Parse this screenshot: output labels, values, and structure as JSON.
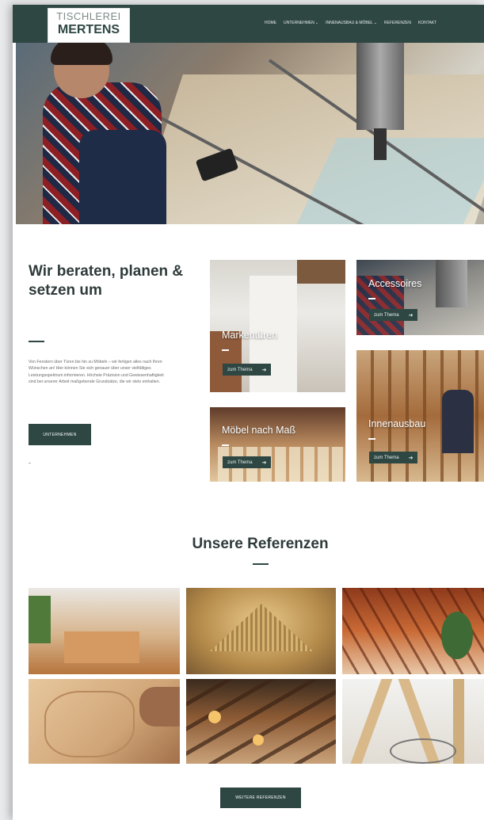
{
  "header": {
    "logo_top": "TISCHLEREI",
    "logo_bottom": "MERTENS",
    "nav": [
      {
        "label": "HOME",
        "dropdown": false
      },
      {
        "label": "UNTERNEHMEN",
        "dropdown": true
      },
      {
        "label": "INNENAUSBAU & MÖBEL",
        "dropdown": true
      },
      {
        "label": "REFERENZEN",
        "dropdown": false
      },
      {
        "label": "KONTAKT",
        "dropdown": false
      }
    ]
  },
  "intro": {
    "title": "Wir beraten, planen & setzen um",
    "text": "Von Fenstern über Türen bis hin zu Möbeln – wir fertigen alles nach Ihren Wünschen an! Hier können Sie sich genauer über unser vielfältiges Leistungsspektrum informieren. Höchste Präzision und Gewissenhaftigkeit sind bei unserer Arbeit maßgebende Grundsätze, die wir stets einhalten.",
    "button": "UNTERNEHMEN"
  },
  "tiles": [
    {
      "caption": "Markentüren",
      "button": "zum Thema",
      "arrow": "➔"
    },
    {
      "caption": "Accessoires",
      "button": "zum Thema",
      "arrow": "➔"
    },
    {
      "caption": "Möbel nach Maß",
      "button": "zum Thema",
      "arrow": "➔"
    },
    {
      "caption": "Innenausbau",
      "button": "zum Thema",
      "arrow": "➔"
    }
  ],
  "references": {
    "title": "Unsere Referenzen",
    "button": "WEITERE REFERENZEN"
  },
  "colors": {
    "primary": "#2e4743",
    "text": "#2e3b3a"
  }
}
